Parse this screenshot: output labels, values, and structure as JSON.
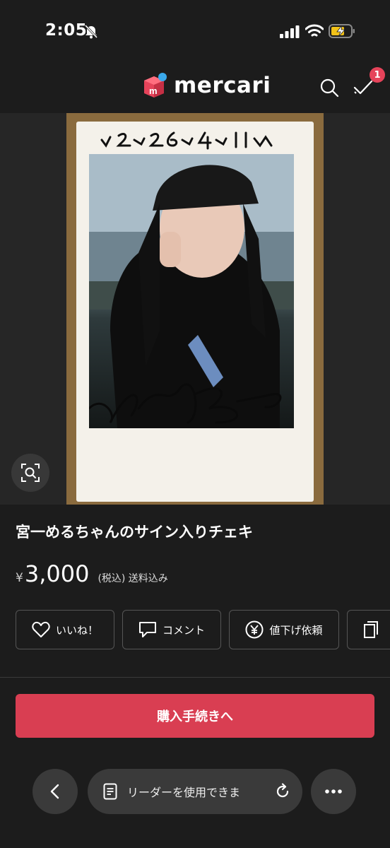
{
  "status_bar": {
    "time": "2:05"
  },
  "header": {
    "brand": "mercari",
    "badge_count": "1",
    "brand_color": "#e6435a"
  },
  "photo": {
    "caption_written": "v2-26-4-11v"
  },
  "product": {
    "title": "宮一めるちゃんのサイン入りチェキ",
    "currency_symbol": "¥",
    "price": "3,000",
    "tax_note": "(税込) 送料込み"
  },
  "actions": {
    "like_label": "いいね！",
    "comment_label": "コメント",
    "price_request_label": "値下げ依頼"
  },
  "purchase": {
    "label": "購入手続きへ",
    "color": "#d93e52"
  },
  "browser": {
    "address_text": "リーダーを使用できま"
  },
  "icons": [
    "bell-slash-icon",
    "signal-icon",
    "wifi-icon",
    "battery-charging-icon",
    "search-icon",
    "checklist-icon",
    "zoom-lens-icon",
    "heart-icon",
    "comment-icon",
    "yen-icon",
    "copy-icon",
    "back-arrow-icon",
    "reader-icon",
    "reload-icon",
    "more-icon"
  ]
}
